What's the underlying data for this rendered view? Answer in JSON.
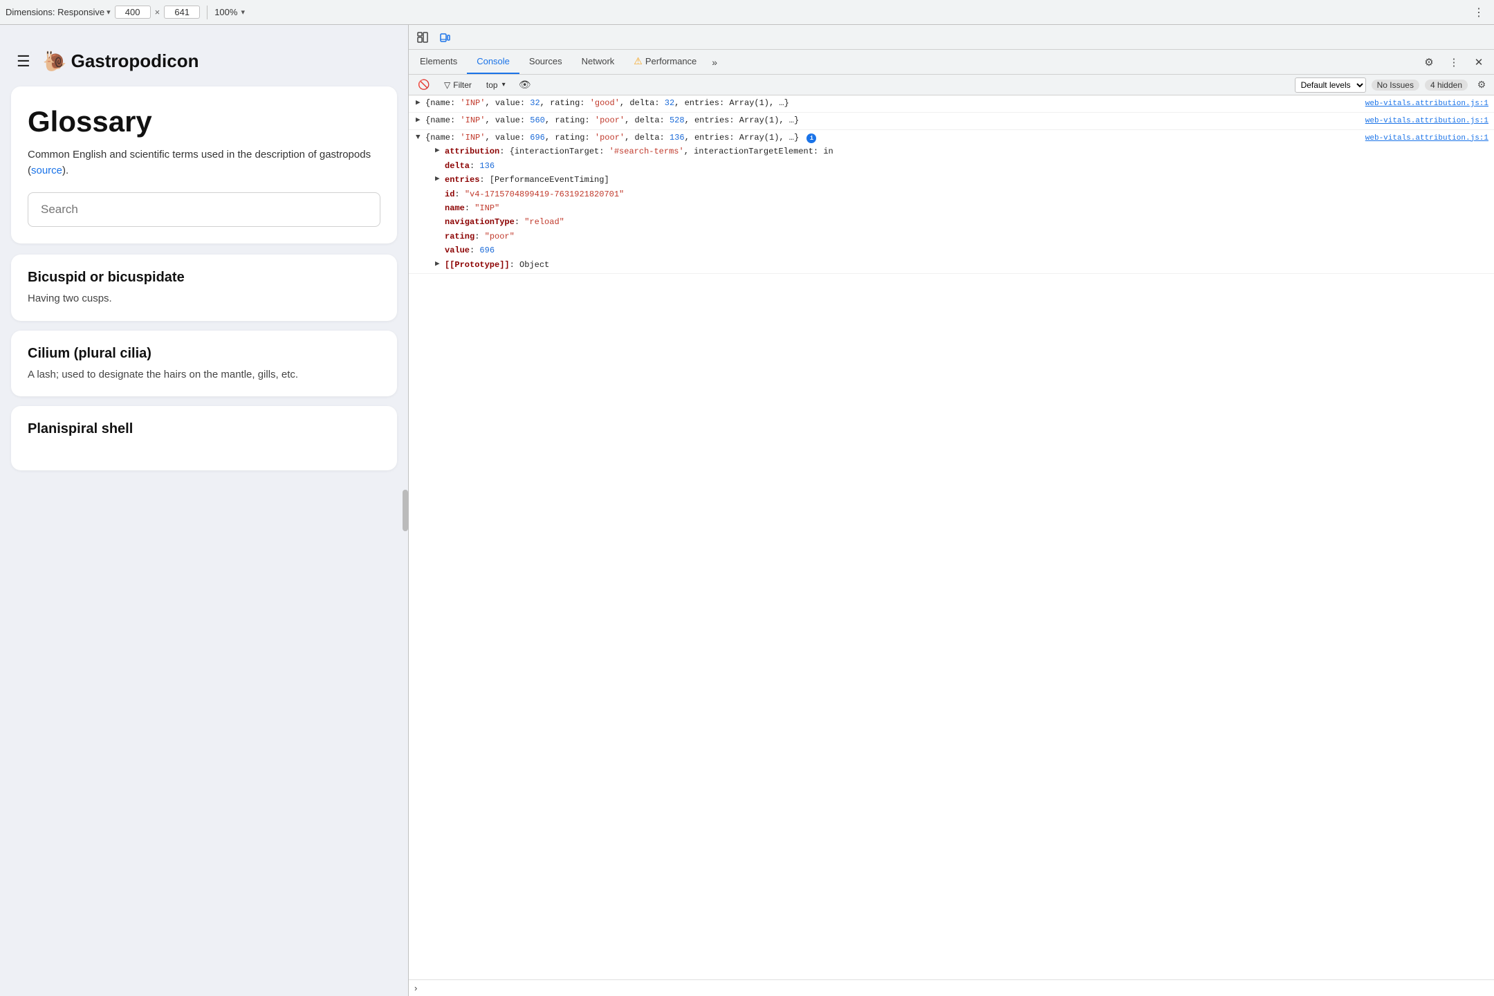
{
  "topbar": {
    "dimensions_label": "Dimensions: Responsive",
    "width": "400",
    "height": "641",
    "zoom": "100%",
    "chevron": "▾"
  },
  "site": {
    "logo_text": "Gastropodicon",
    "snail": "🐌"
  },
  "glossary": {
    "title": "Glossary",
    "description": "Common English and scientific terms used in the description of gastropods (",
    "source_link": "source",
    "description_end": ").",
    "search_placeholder": "Search"
  },
  "terms": [
    {
      "title": "Bicuspid or bicuspidate",
      "description": "Having two cusps."
    },
    {
      "title": "Cilium (plural cilia)",
      "description": "A lash; used to designate the hairs on the mantle, gills, etc."
    },
    {
      "title": "Planispiral shell",
      "description": ""
    }
  ],
  "devtools": {
    "tabs": [
      {
        "label": "Elements",
        "active": false
      },
      {
        "label": "Console",
        "active": true
      },
      {
        "label": "Sources",
        "active": false
      },
      {
        "label": "Network",
        "active": false
      },
      {
        "label": "Performance",
        "active": false
      }
    ],
    "console_toolbar": {
      "top_label": "top",
      "filter_label": "Filter",
      "levels_label": "Default levels",
      "levels_chevron": "▾",
      "no_issues": "No Issues",
      "hidden_badge": "4 hidden"
    },
    "console_entries": [
      {
        "id": "entry1",
        "source": "web-vitals.attribution.js:1",
        "collapsed": true,
        "content": "{name: 'INP', value: 32, rating: 'good', delta: 32, entries: Array(1), …}"
      },
      {
        "id": "entry2",
        "source": "web-vitals.attribution.js:1",
        "collapsed": true,
        "content": "{name: 'INP', value: 560, rating: 'poor', delta: 528, entries: Array(1), …}"
      },
      {
        "id": "entry3",
        "source": "web-vitals.attribution.js:1",
        "collapsed": false,
        "content": "{name: 'INP', value: 696, rating: 'poor', delta: 136, entries: Array(1), …}",
        "children": [
          {
            "key": "attribution",
            "value": "{interactionTarget: '#search-terms', interactionTargetElement: in",
            "collapsed": true
          },
          {
            "key": "delta",
            "value": "136",
            "type": "num",
            "collapsed": false
          },
          {
            "key": "entries",
            "value": "[PerformanceEventTiming]",
            "collapsed": true
          },
          {
            "key": "id",
            "value": "\"v4-1715704899419-7631921820701\"",
            "type": "str",
            "collapsed": false
          },
          {
            "key": "name",
            "value": "\"INP\"",
            "type": "str",
            "collapsed": false
          },
          {
            "key": "navigationType",
            "value": "\"reload\"",
            "type": "str",
            "collapsed": false
          },
          {
            "key": "rating",
            "value": "\"poor\"",
            "type": "str",
            "collapsed": false
          },
          {
            "key": "value",
            "value": "696",
            "type": "num",
            "collapsed": false
          },
          {
            "key": "[[Prototype]]",
            "value": "Object",
            "type": "obj",
            "collapsed": true
          }
        ]
      }
    ]
  }
}
